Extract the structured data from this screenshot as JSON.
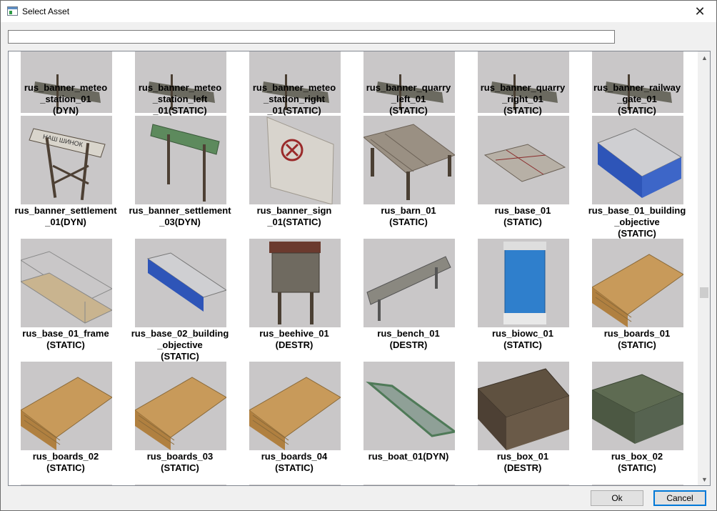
{
  "window": {
    "title": "Select Asset",
    "close_glyph": "✕"
  },
  "search": {
    "value": "",
    "placeholder": ""
  },
  "rows": [
    [
      {
        "label": "rus_banner_meteo\n_station_01\n(DYN)",
        "icon": "banner-sign"
      },
      {
        "label": "rus_banner_meteo\n_station_left\n_01(STATIC)",
        "icon": "banner-sign"
      },
      {
        "label": "rus_banner_meteo\n_station_right\n_01(STATIC)",
        "icon": "banner-sign"
      },
      {
        "label": "rus_banner_quarry\n_left_01\n(STATIC)",
        "icon": "banner-sign"
      },
      {
        "label": "rus_banner_quarry\n_right_01\n(STATIC)",
        "icon": "banner-sign"
      },
      {
        "label": "rus_banner_railway\n_gate_01\n(STATIC)",
        "icon": "banner-sign"
      }
    ],
    [
      {
        "label": "rus_banner_settlement\n_01(DYN)",
        "icon": "settlement-sign"
      },
      {
        "label": "rus_banner_settlement\n_03(DYN)",
        "icon": "settlement-sign-green"
      },
      {
        "label": "rus_banner_sign\n_01(STATIC)",
        "icon": "sign-board"
      },
      {
        "label": "rus_barn_01\n(STATIC)",
        "icon": "barn"
      },
      {
        "label": "rus_base_01\n(STATIC)",
        "icon": "base-foundation"
      },
      {
        "label": "rus_base_01_building\n_objective\n(STATIC)",
        "icon": "blue-building"
      }
    ],
    [
      {
        "label": "rus_base_01_frame\n(STATIC)",
        "icon": "building-frame"
      },
      {
        "label": "rus_base_02_building\n_objective\n(STATIC)",
        "icon": "blue-building-long"
      },
      {
        "label": "rus_beehive_01\n(DESTR)",
        "icon": "beehive"
      },
      {
        "label": "rus_bench_01\n(DESTR)",
        "icon": "bench"
      },
      {
        "label": "rus_biowc_01\n(STATIC)",
        "icon": "portable-toilet"
      },
      {
        "label": "rus_boards_01\n(STATIC)",
        "icon": "boards"
      }
    ],
    [
      {
        "label": "rus_boards_02\n(STATIC)",
        "icon": "boards"
      },
      {
        "label": "rus_boards_03\n(STATIC)",
        "icon": "boards"
      },
      {
        "label": "rus_boards_04\n(STATIC)",
        "icon": "boards"
      },
      {
        "label": "rus_boat_01(DYN)",
        "icon": "boat"
      },
      {
        "label": "rus_box_01\n(DESTR)",
        "icon": "wooden-crate"
      },
      {
        "label": "rus_box_02\n(STATIC)",
        "icon": "green-crate"
      }
    ]
  ],
  "buttons": {
    "ok": "Ok",
    "cancel": "Cancel"
  },
  "scrollbar": {
    "up_glyph": "▲",
    "down_glyph": "▼"
  }
}
